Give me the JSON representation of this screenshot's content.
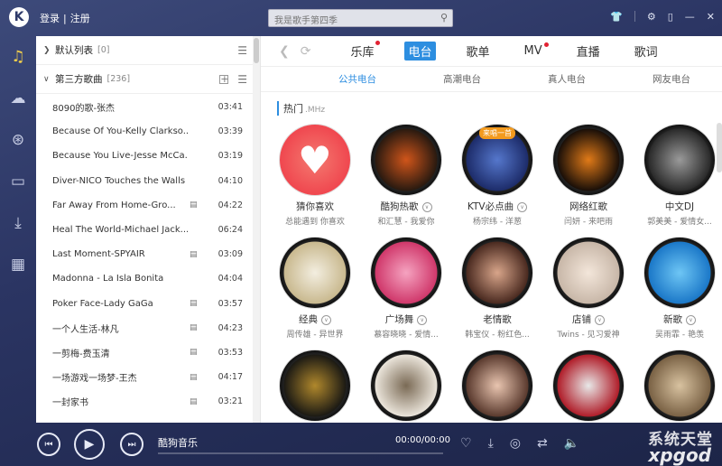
{
  "header": {
    "login": "登录",
    "separator": "|",
    "register": "注册",
    "search_placeholder": "我是歌手第四季"
  },
  "left_nav": [
    "music-note-icon",
    "cloud-icon",
    "radio-antenna-icon",
    "device-icon",
    "download-icon",
    "apps-grid-icon"
  ],
  "playlist": {
    "default_list": {
      "title": "默认列表",
      "count": "[0]"
    },
    "third_party": {
      "title": "第三方歌曲",
      "count": "[236]"
    },
    "songs": [
      {
        "title": "8090的歌-张杰",
        "duration": "03:41",
        "mv": false
      },
      {
        "title": "Because Of You-Kelly Clarkso...",
        "duration": "03:39",
        "mv": false
      },
      {
        "title": "Because You Live-Jesse McCa...",
        "duration": "03:19",
        "mv": false
      },
      {
        "title": "Diver-NICO Touches the Walls",
        "duration": "04:10",
        "mv": false
      },
      {
        "title": "Far Away From Home-Gro...",
        "duration": "04:22",
        "mv": true
      },
      {
        "title": "Heal The World-Michael Jack...",
        "duration": "06:24",
        "mv": false
      },
      {
        "title": "Last Moment-SPYAIR",
        "duration": "03:09",
        "mv": true
      },
      {
        "title": "Madonna  - La Isla Bonita",
        "duration": "04:04",
        "mv": false
      },
      {
        "title": "Poker Face-Lady GaGa",
        "duration": "03:57",
        "mv": true
      },
      {
        "title": "一个人生活-林凡",
        "duration": "04:23",
        "mv": true
      },
      {
        "title": "一剪梅-费玉清",
        "duration": "03:53",
        "mv": true
      },
      {
        "title": "一场游戏一场梦-王杰",
        "duration": "04:17",
        "mv": true
      },
      {
        "title": "一封家书",
        "duration": "03:21",
        "mv": true
      }
    ]
  },
  "main": {
    "tabs": [
      {
        "label": "乐库",
        "dot": true,
        "active": false
      },
      {
        "label": "电台",
        "dot": false,
        "active": true
      },
      {
        "label": "歌单",
        "dot": false,
        "active": false
      },
      {
        "label": "MV",
        "dot": true,
        "active": false
      },
      {
        "label": "直播",
        "dot": false,
        "active": false
      },
      {
        "label": "歌词",
        "dot": false,
        "active": false
      }
    ],
    "subtabs": [
      {
        "label": "公共电台",
        "active": true
      },
      {
        "label": "高潮电台",
        "active": false
      },
      {
        "label": "真人电台",
        "active": false
      },
      {
        "label": "网友电台",
        "active": false
      }
    ],
    "section": {
      "title": "热门",
      "sub": ".MHz"
    },
    "stations": [
      {
        "name": "猜你喜欢",
        "desc": "总能遇到 你喜欢",
        "dropdown": false,
        "badge": "",
        "color1": "#f0474f",
        "color2": "#f37a70"
      },
      {
        "name": "酷狗热歌",
        "desc": "和汇慧 - 我爱你",
        "dropdown": true,
        "badge": "",
        "color1": "#2a1a10",
        "color2": "#d0551a"
      },
      {
        "name": "KTV必点曲",
        "desc": "杨宗纬 - 洋葱",
        "dropdown": true,
        "badge": "来唱一首",
        "color1": "#1d2c6a",
        "color2": "#5577cc"
      },
      {
        "name": "网络红歌",
        "desc": "闫妍 - 来吧雨",
        "dropdown": false,
        "badge": "",
        "color1": "#1a0f08",
        "color2": "#e07a18"
      },
      {
        "name": "中文DJ",
        "desc": "郭美美 - 爱情女...",
        "dropdown": false,
        "badge": "",
        "color1": "#2b2b2b",
        "color2": "#9a9a9a"
      },
      {
        "name": "经典",
        "desc": "周传雄 - 异世界",
        "dropdown": true,
        "badge": "",
        "color1": "#c9b98f",
        "color2": "#f3eee0"
      },
      {
        "name": "广场舞",
        "desc": "慕容晓晓 - 爱情...",
        "dropdown": true,
        "badge": "",
        "color1": "#d0386b",
        "color2": "#f5a3c0"
      },
      {
        "name": "老情歌",
        "desc": "韩宝仪 - 粉红色...",
        "dropdown": false,
        "badge": "",
        "color1": "#4a2a20",
        "color2": "#d8a58a"
      },
      {
        "name": "店铺",
        "desc": "Twins - 见习爱神",
        "dropdown": true,
        "badge": "",
        "color1": "#c8b7a8",
        "color2": "#f3e6da"
      },
      {
        "name": "新歌",
        "desc": "吴雨霏 - 艳羡",
        "dropdown": true,
        "badge": "",
        "color1": "#1b78c8",
        "color2": "#6ec6f5"
      },
      {
        "name": "",
        "desc": "",
        "dropdown": false,
        "badge": "",
        "color1": "#1c1a14",
        "color2": "#b0882c"
      },
      {
        "name": "",
        "desc": "",
        "dropdown": false,
        "badge": "",
        "color1": "#eae4da",
        "color2": "#7a6a55"
      },
      {
        "name": "",
        "desc": "",
        "dropdown": false,
        "badge": "",
        "color1": "#5a3a2e",
        "color2": "#e9c5b0"
      },
      {
        "name": "",
        "desc": "",
        "dropdown": false,
        "badge": "",
        "color1": "#b01e2a",
        "color2": "#e8e8e8"
      },
      {
        "name": "",
        "desc": "",
        "dropdown": false,
        "badge": "",
        "color1": "#7a6245",
        "color2": "#d8c2a0"
      }
    ]
  },
  "player": {
    "title": "酷狗音乐",
    "time": "00:00/00:00"
  },
  "watermark": {
    "line1": "系统天堂",
    "line2": "xpgod"
  },
  "colors": {
    "accent": "#2d8ee0",
    "badge": "#f39a1e",
    "dot": "#e22233",
    "active_nav": "#f5d14b"
  }
}
